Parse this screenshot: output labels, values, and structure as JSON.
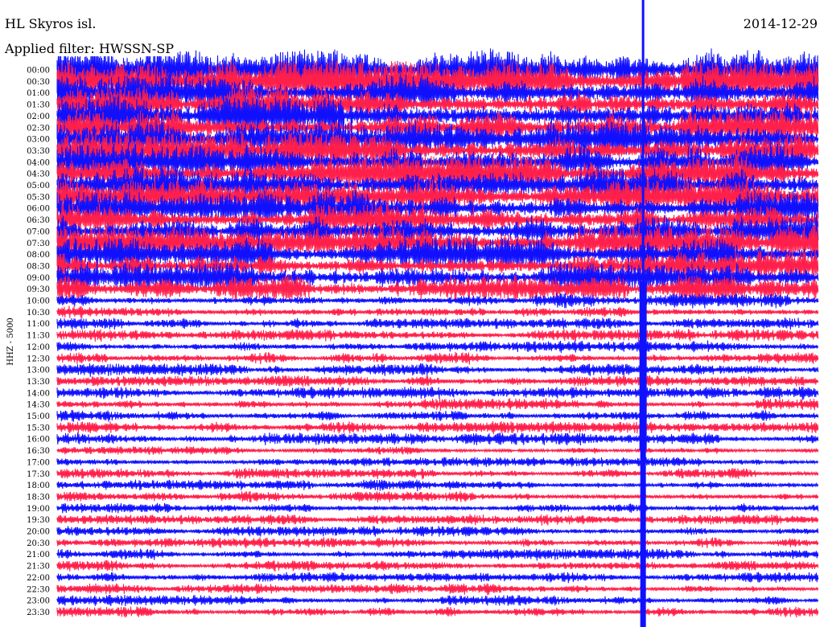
{
  "header": {
    "station": "HL Skyros isl.",
    "date": "2014-12-29",
    "filter_label": "Applied filter: HWSSN-SP"
  },
  "colors": {
    "trace_a": "#1010ff",
    "trace_b": "#ff1f4b",
    "background": "#ffffff",
    "text": "#000000"
  },
  "chart_data": {
    "type": "line",
    "title": "HL Skyros isl.",
    "ylabel": "HHZ - 5000",
    "xlabel": "",
    "grid": false,
    "legend": "none",
    "row_labels": [
      "00:00",
      "00:30",
      "01:00",
      "01:30",
      "02:00",
      "02:30",
      "03:00",
      "03:30",
      "04:00",
      "04:30",
      "05:00",
      "05:30",
      "06:00",
      "06:30",
      "07:00",
      "07:30",
      "08:00",
      "08:30",
      "09:00",
      "09:30",
      "10:00",
      "10:30",
      "11:00",
      "11:30",
      "12:00",
      "12:30",
      "13:00",
      "13:30",
      "14:00",
      "14:30",
      "15:00",
      "15:30",
      "16:00",
      "16:30",
      "17:00",
      "17:30",
      "18:00",
      "18:30",
      "19:00",
      "19:30",
      "20:00",
      "20:30",
      "21:00",
      "21:30",
      "22:00",
      "22:30",
      "23:00",
      "23:30"
    ],
    "row_colors": [
      "trace_a",
      "trace_b",
      "trace_a",
      "trace_b",
      "trace_a",
      "trace_b",
      "trace_a",
      "trace_b",
      "trace_a",
      "trace_b",
      "trace_a",
      "trace_b",
      "trace_a",
      "trace_b",
      "trace_a",
      "trace_b",
      "trace_a",
      "trace_b",
      "trace_a",
      "trace_b",
      "trace_a",
      "trace_b",
      "trace_a",
      "trace_b",
      "trace_a",
      "trace_b",
      "trace_a",
      "trace_b",
      "trace_a",
      "trace_b",
      "trace_a",
      "trace_b",
      "trace_a",
      "trace_b",
      "trace_a",
      "trace_b",
      "trace_a",
      "trace_b",
      "trace_a",
      "trace_b",
      "trace_a",
      "trace_b",
      "trace_a",
      "trace_b",
      "trace_a",
      "trace_b",
      "trace_a",
      "trace_b"
    ],
    "noise_amplitude_relative": [
      1.6,
      1.5,
      1.5,
      1.4,
      1.5,
      1.4,
      1.4,
      1.4,
      1.4,
      1.3,
      1.3,
      1.3,
      1.3,
      1.2,
      1.2,
      1.3,
      1.2,
      1.1,
      1.1,
      1.0,
      0.55,
      0.5,
      0.45,
      0.45,
      0.45,
      0.45,
      0.45,
      0.45,
      0.45,
      0.45,
      0.45,
      0.45,
      0.45,
      0.3,
      0.35,
      0.4,
      0.4,
      0.4,
      0.4,
      0.4,
      0.4,
      0.4,
      0.4,
      0.4,
      0.4,
      0.4,
      0.4,
      0.4
    ],
    "event": {
      "time_fraction_of_row": 0.77,
      "start_row": "00:00",
      "end_row": "23:30"
    }
  }
}
